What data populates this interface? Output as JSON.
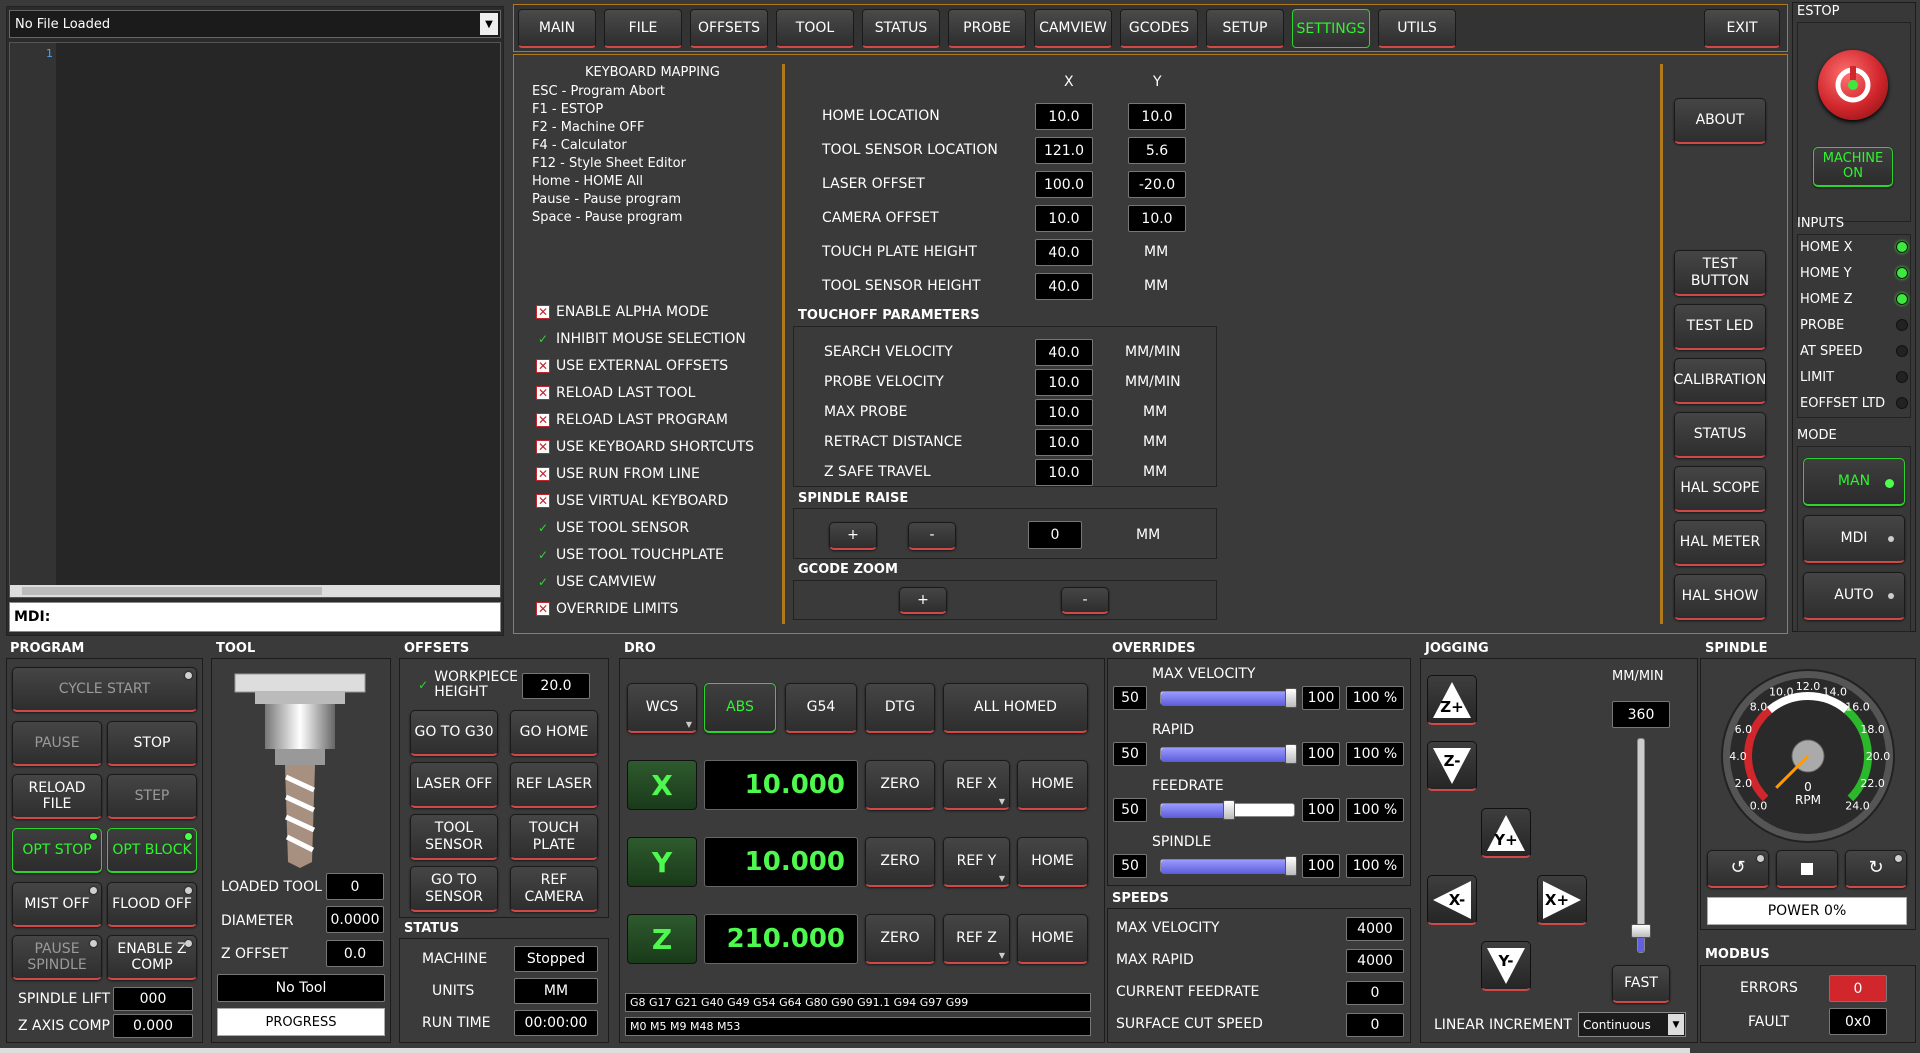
{
  "file": {
    "title": "No File Loaded",
    "line_no": "1",
    "mdi_label": "MDI:"
  },
  "tabs": [
    "MAIN",
    "FILE",
    "OFFSETS",
    "TOOL",
    "STATUS",
    "PROBE",
    "CAMVIEW",
    "GCODES",
    "SETUP",
    "SETTINGS",
    "UTILS"
  ],
  "exit_label": "EXIT",
  "keyboard": {
    "title": "KEYBOARD MAPPING",
    "lines": [
      "ESC - Program Abort",
      "F1 - ESTOP",
      "F2 - Machine OFF",
      "F4 - Calculator",
      "F12 - Style Sheet Editor",
      "Home - HOME All",
      "Pause - Pause program",
      "Space - Pause program"
    ]
  },
  "options": [
    {
      "label": "ENABLE ALPHA MODE",
      "checked": false
    },
    {
      "label": "INHIBIT MOUSE SELECTION",
      "checked": true
    },
    {
      "label": "USE EXTERNAL OFFSETS",
      "checked": false
    },
    {
      "label": "RELOAD LAST TOOL",
      "checked": false
    },
    {
      "label": "RELOAD LAST PROGRAM",
      "checked": false
    },
    {
      "label": "USE KEYBOARD SHORTCUTS",
      "checked": false
    },
    {
      "label": "USE RUN FROM LINE",
      "checked": false
    },
    {
      "label": "USE VIRTUAL KEYBOARD",
      "checked": false
    },
    {
      "label": "USE TOOL SENSOR",
      "checked": true
    },
    {
      "label": "USE TOOL TOUCHPLATE",
      "checked": true
    },
    {
      "label": "USE CAMVIEW",
      "checked": true
    },
    {
      "label": "OVERRIDE LIMITS",
      "checked": false
    }
  ],
  "locations": {
    "col_x": "X",
    "col_y": "Y",
    "rows": [
      {
        "label": "HOME LOCATION",
        "x": "10.0",
        "y": "10.0"
      },
      {
        "label": "TOOL SENSOR LOCATION",
        "x": "121.0",
        "y": "5.6"
      },
      {
        "label": "LASER OFFSET",
        "x": "100.0",
        "y": "-20.0"
      },
      {
        "label": "CAMERA OFFSET",
        "x": "10.0",
        "y": "10.0"
      },
      {
        "label": "TOUCH PLATE HEIGHT",
        "x": "40.0",
        "unit": "MM"
      },
      {
        "label": "TOOL SENSOR HEIGHT",
        "x": "40.0",
        "unit": "MM"
      }
    ]
  },
  "touchoff": {
    "title": "TOUCHOFF PARAMETERS",
    "rows": [
      {
        "label": "SEARCH VELOCITY",
        "value": "40.0",
        "unit": "MM/MIN"
      },
      {
        "label": "PROBE VELOCITY",
        "value": "10.0",
        "unit": "MM/MIN"
      },
      {
        "label": "MAX PROBE",
        "value": "10.0",
        "unit": "MM"
      },
      {
        "label": "RETRACT DISTANCE",
        "value": "10.0",
        "unit": "MM"
      },
      {
        "label": "Z SAFE TRAVEL",
        "value": "10.0",
        "unit": "MM"
      }
    ]
  },
  "spindle_raise": {
    "title": "SPINDLE RAISE",
    "plus": "+",
    "minus": "-",
    "value": "0",
    "unit": "MM"
  },
  "gcode_zoom": {
    "title": "GCODE ZOOM",
    "plus": "+",
    "minus": "-"
  },
  "side_buttons": [
    "ABOUT",
    "TEST BUTTON",
    "TEST LED",
    "CALIBRATION",
    "STATUS",
    "HAL SCOPE",
    "HAL METER",
    "HAL SHOW"
  ],
  "estop": {
    "title": "ESTOP",
    "machine_on": "MACHINE ON"
  },
  "inputs": {
    "title": "INPUTS",
    "items": [
      {
        "label": "HOME X",
        "on": true
      },
      {
        "label": "HOME Y",
        "on": true
      },
      {
        "label": "HOME Z",
        "on": true
      },
      {
        "label": "PROBE",
        "on": false
      },
      {
        "label": "AT SPEED",
        "on": false
      },
      {
        "label": "LIMIT",
        "on": false
      },
      {
        "label": "EOFFSET LTD",
        "on": false
      }
    ]
  },
  "mode": {
    "title": "MODE",
    "man": "MAN",
    "mdi": "MDI",
    "auto": "AUTO"
  },
  "program": {
    "title": "PROGRAM",
    "cycle_start": "CYCLE START",
    "pause": "PAUSE",
    "stop": "STOP",
    "reload": "RELOAD FILE",
    "step": "STEP",
    "opt_stop": "OPT STOP",
    "opt_block": "OPT BLOCK",
    "mist": "MIST OFF",
    "flood": "FLOOD OFF",
    "pause_spindle": "PAUSE SPINDLE",
    "enable_z": "ENABLE Z COMP",
    "spindle_lift_label": "SPINDLE LIFT",
    "spindle_lift": "000",
    "z_axis_comp_label": "Z AXIS COMP",
    "z_axis_comp": "0.000"
  },
  "tool": {
    "title": "TOOL",
    "loaded_label": "LOADED TOOL",
    "loaded": "0",
    "diameter_label": "DIAMETER",
    "diameter": "0.0000",
    "zoffset_label": "Z OFFSET",
    "zoffset": "0.0",
    "name": "No Tool",
    "progress": "PROGRESS"
  },
  "offsets": {
    "title": "OFFSETS",
    "workpiece_label": "WORKPIECE HEIGHT",
    "workpiece": "20.0",
    "b1": "GO TO G30",
    "b2": "GO HOME",
    "b3": "LASER OFF",
    "b4": "REF LASER",
    "b5": "TOOL SENSOR",
    "b6": "TOUCH PLATE",
    "b7": "GO TO SENSOR",
    "b8": "REF CAMERA"
  },
  "status": {
    "title": "STATUS",
    "machine_label": "MACHINE",
    "machine": "Stopped",
    "units_label": "UNITS",
    "units": "MM",
    "runtime_label": "RUN TIME",
    "runtime": "00:00:00"
  },
  "dro": {
    "title": "DRO",
    "wcs": "WCS",
    "abs": "ABS",
    "g54": "G54",
    "dtg": "DTG",
    "all_homed": "ALL HOMED",
    "axes": [
      {
        "name": "X",
        "value": "10.000",
        "ref": "REF X"
      },
      {
        "name": "Y",
        "value": "10.000",
        "ref": "REF Y"
      },
      {
        "name": "Z",
        "value": "210.000",
        "ref": "REF Z"
      }
    ],
    "zero": "ZERO",
    "home": "HOME",
    "gcodes": "G8 G17 G21 G40 G49 G54 G64 G80 G90 G91.1 G94 G97 G99",
    "mcodes": "M0 M5 M9 M48 M53"
  },
  "overrides": {
    "title": "OVERRIDES",
    "items": [
      {
        "label": "MAX VELOCITY",
        "min": "50",
        "max": "100",
        "value": "100 %",
        "fraction": 1.0
      },
      {
        "label": "RAPID",
        "min": "50",
        "max": "100",
        "value": "100 %",
        "fraction": 1.0
      },
      {
        "label": "FEEDRATE",
        "min": "50",
        "max": "100",
        "value": "100 %",
        "fraction": 0.5
      },
      {
        "label": "SPINDLE",
        "min": "50",
        "max": "100",
        "value": "100 %",
        "fraction": 1.0
      }
    ]
  },
  "speeds": {
    "title": "SPEEDS",
    "items": [
      {
        "label": "MAX VELOCITY",
        "value": "4000"
      },
      {
        "label": "MAX RAPID",
        "value": "4000"
      },
      {
        "label": "CURRENT FEEDRATE",
        "value": "0"
      },
      {
        "label": "SURFACE CUT SPEED",
        "value": "0"
      }
    ]
  },
  "jogging": {
    "title": "JOGGING",
    "units": "MM/MIN",
    "rate": "360",
    "fast": "FAST",
    "increment_label": "LINEAR INCREMENT",
    "increment": "Continuous",
    "zp": "Z+",
    "zm": "Z-",
    "yp": "Y+",
    "ym": "Y-",
    "xp": "X+",
    "xm": "X-"
  },
  "spindle": {
    "title": "SPINDLE",
    "rpm_value": "0",
    "rpm_label": "RPM",
    "ticks": [
      "0.0",
      "2.0",
      "4.0",
      "6.0",
      "8.0",
      "10.0",
      "12.0",
      "14.0",
      "16.0",
      "18.0",
      "20.0",
      "22.0",
      "24.0"
    ],
    "power": "POWER 0%"
  },
  "modbus": {
    "title": "MODBUS",
    "errors_label": "ERRORS",
    "errors": "0",
    "fault_label": "FAULT",
    "fault": "0x0"
  },
  "colors": {
    "accent_green": "#2ef52e",
    "alarm_red": "#d0262c",
    "gauge_green": "#2bb82b"
  }
}
